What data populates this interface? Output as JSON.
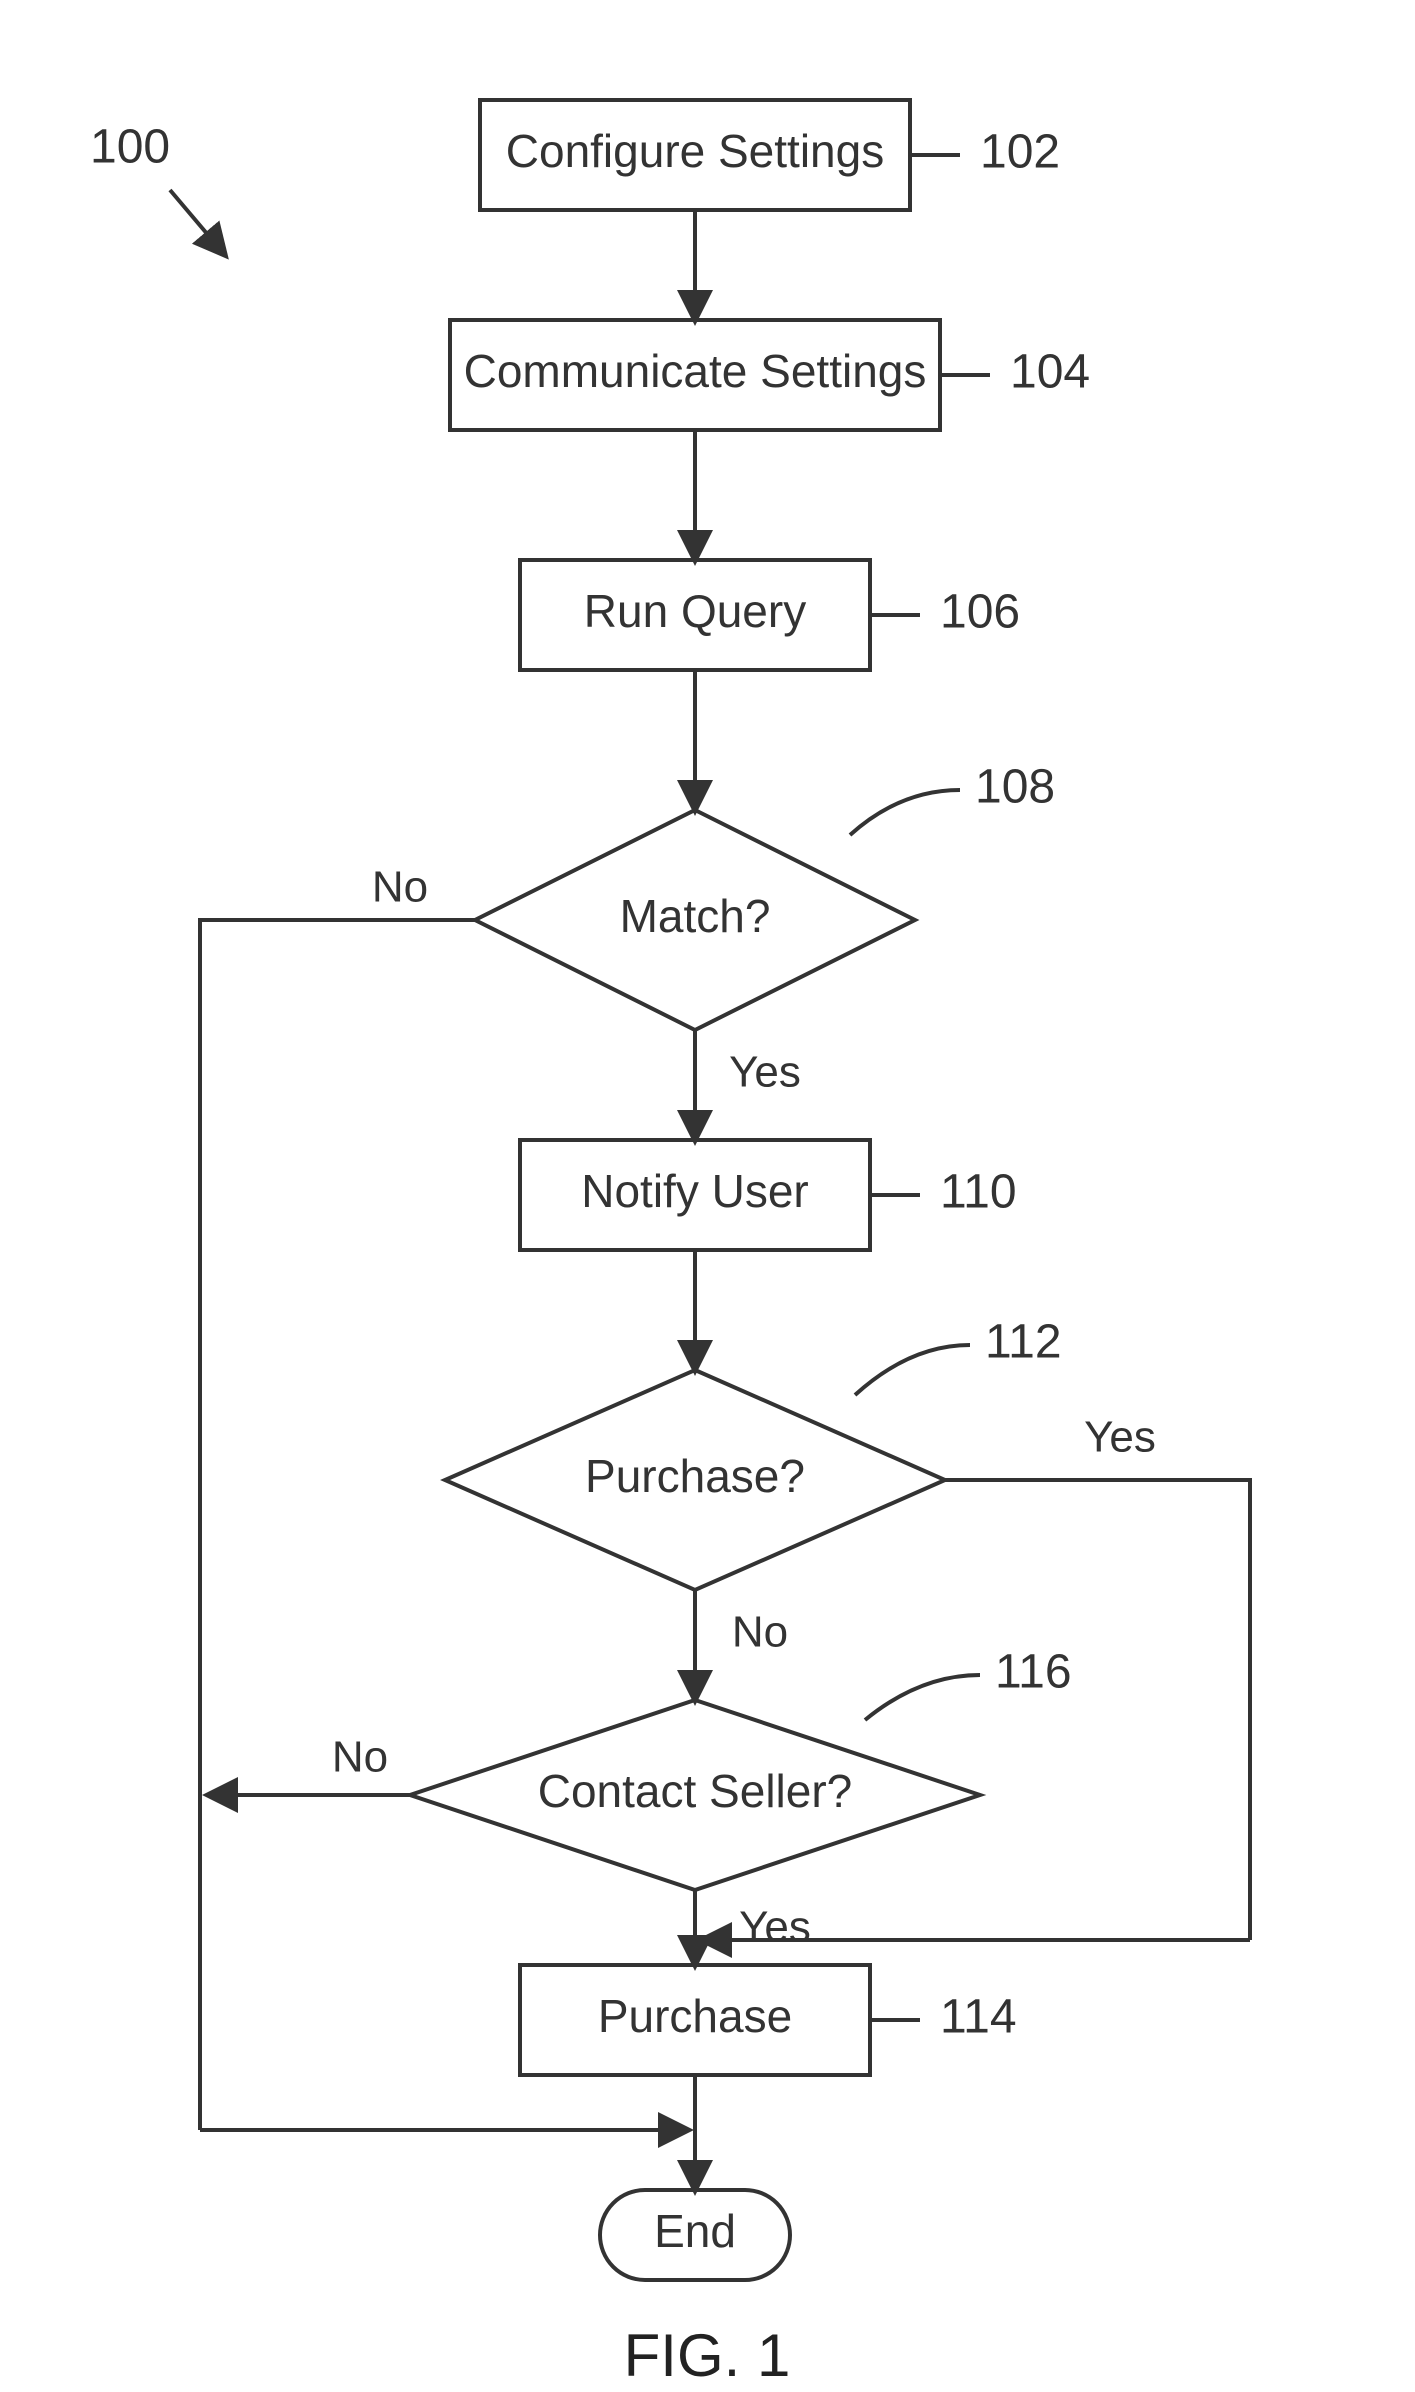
{
  "diagram": {
    "refMain": "100",
    "figureCaption": "FIG. 1",
    "nodes": {
      "configure": {
        "label": "Configure Settings",
        "ref": "102"
      },
      "communicate": {
        "label": "Communicate Settings",
        "ref": "104"
      },
      "runQuery": {
        "label": "Run Query",
        "ref": "106"
      },
      "match": {
        "label": "Match?",
        "ref": "108"
      },
      "notify": {
        "label": "Notify User",
        "ref": "110"
      },
      "purchaseQ": {
        "label": "Purchase?",
        "ref": "112"
      },
      "contactSeller": {
        "label": "Contact Seller?",
        "ref": "116"
      },
      "purchase": {
        "label": "Purchase",
        "ref": "114"
      },
      "end": {
        "label": "End"
      }
    },
    "edges": {
      "yes": "Yes",
      "no": "No"
    }
  }
}
